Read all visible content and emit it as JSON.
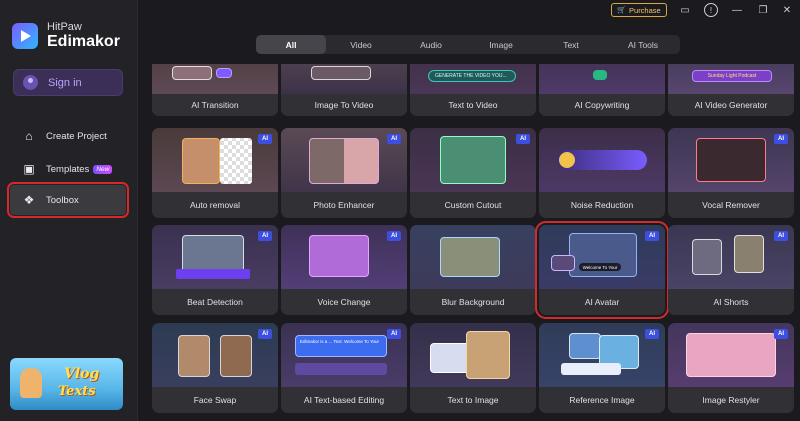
{
  "app": {
    "brand_top": "HitPaw",
    "brand_bottom": "Edimakor",
    "sign_in": "Sign in"
  },
  "sidebar": {
    "items": [
      {
        "label": "Create Project",
        "icon": "home-icon"
      },
      {
        "label": "Templates",
        "icon": "templates-icon",
        "badge": "New"
      },
      {
        "label": "Toolbox",
        "icon": "toolbox-icon",
        "selected": true
      }
    ],
    "promo_line1": "Vlog",
    "promo_line2": "Texts"
  },
  "topbar": {
    "purchase": "Purchase"
  },
  "tabs": [
    "All",
    "Video",
    "Audio",
    "Image",
    "Text",
    "AI Tools"
  ],
  "active_tab": "All",
  "ai_badge": "AI",
  "tools": {
    "row0": [
      "AI Transition",
      "Image To Video",
      "Text to Video",
      "AI Copywriting",
      "AI Video Generator"
    ],
    "row1": [
      "Auto removal",
      "Photo Enhancer",
      "Custom Cutout",
      "Noise Reduction",
      "Vocal Remover"
    ],
    "row2": [
      "Beat Detection",
      "Voice Change",
      "Blur Background",
      "AI Avatar",
      "AI Shorts"
    ],
    "row3": [
      "Face Swap",
      "AI Text-based Editing",
      "Text to Image",
      "Reference Image",
      "Image Restyler"
    ]
  },
  "thumb_text": {
    "text_to_video": "GENERATE THE VIDEO YOU...",
    "ai_video_generator": "Sunday Light Podcast",
    "avatar_caption": "Welcome To Your",
    "text_editing": "Edimakor is a ... Text. Welcome To Your"
  },
  "colors": {
    "selection_outline": "#d42a2a",
    "ai_badge": "#3c4fe0",
    "accent": "#7b4dff",
    "purchase": "#d9a944"
  }
}
